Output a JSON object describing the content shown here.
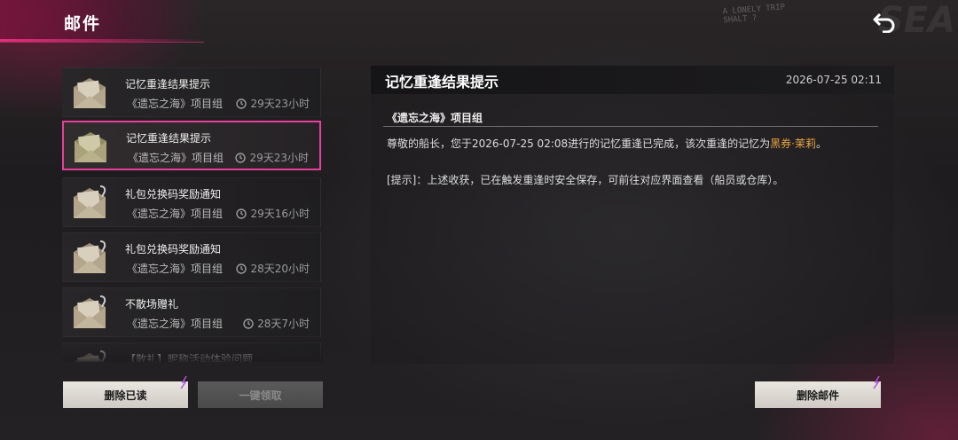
{
  "header": {
    "title": "邮件",
    "deco_text": "A LONELY TRIP\nSHALT ?",
    "deco_big": "SEA"
  },
  "mails": [
    {
      "subject": "记忆重逢结果提示",
      "sender": "《遗忘之海》项目组",
      "time": "29天23小时",
      "icon": "open-envelope-icon",
      "attachment": false
    },
    {
      "subject": "记忆重逢结果提示",
      "sender": "《遗忘之海》项目组",
      "time": "29天23小时",
      "icon": "open-envelope-icon",
      "attachment": false,
      "selected": true
    },
    {
      "subject": "礼包兑换码奖励通知",
      "sender": "《遗忘之海》项目组",
      "time": "29天16小时",
      "icon": "open-envelope-icon",
      "attachment": true
    },
    {
      "subject": "礼包兑换码奖励通知",
      "sender": "《遗忘之海》项目组",
      "time": "28天20小时",
      "icon": "open-envelope-icon",
      "attachment": true
    },
    {
      "subject": "不散场赠礼",
      "sender": "《遗忘之海》项目组",
      "time": "28天7小时",
      "icon": "open-envelope-icon",
      "attachment": true
    },
    {
      "subject": "【散礼】昵称活动体验问题",
      "sender": "",
      "time": "",
      "icon": "open-envelope-icon",
      "attachment": true
    }
  ],
  "buttons": {
    "delete_read": "删除已读",
    "collect_all": "一键领取",
    "delete_mail": "删除邮件"
  },
  "detail": {
    "subject": "记忆重逢结果提示",
    "date": "2026-07-25 02:11",
    "sender": "《遗忘之海》项目组",
    "body_prefix": "尊敬的船长，您于2026-07-25 02:08进行的记忆重逢已完成，该次重逢的记忆为",
    "body_highlight": "黑券·茉莉",
    "body_suffix": "。",
    "tip": "[提示]：上述收获，已在触发重逢时安全保存，可前往对应界面查看（船员或仓库）。"
  },
  "colors": {
    "accent": "#e83f9b",
    "highlight": "#e8a442"
  }
}
